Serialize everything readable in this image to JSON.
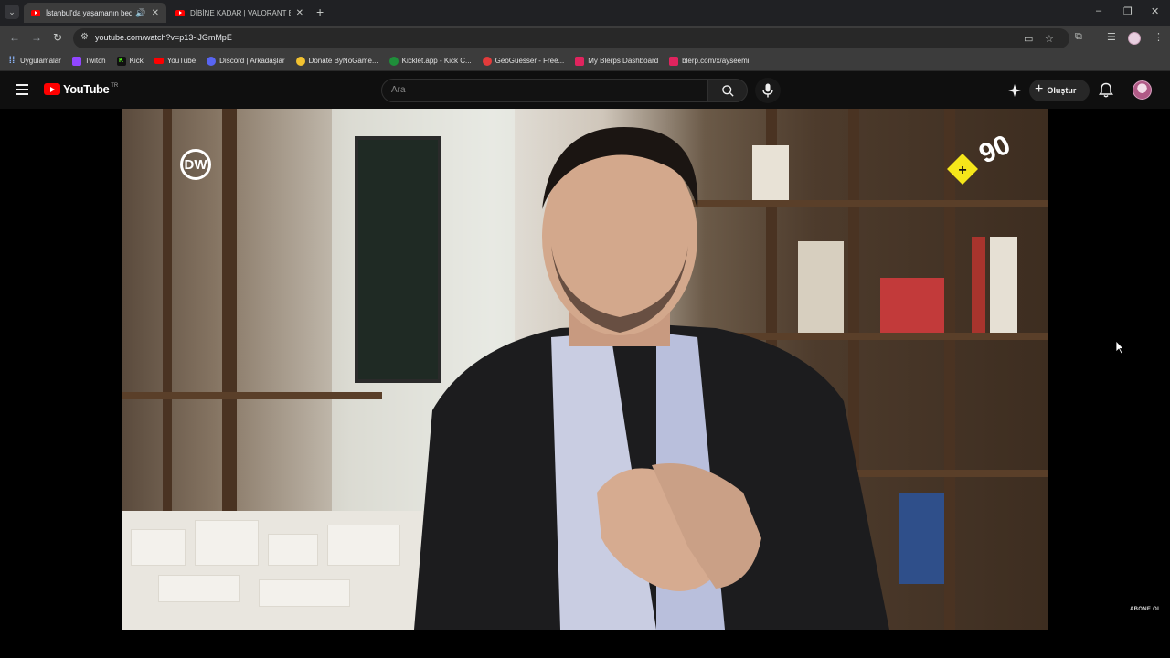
{
  "browser": {
    "tabs": [
      {
        "title": "İstanbul'da yaşamanın bedeli",
        "active": true,
        "audio": true,
        "favicon": "youtube-icon"
      },
      {
        "title": "DİBİNE KADAR | VALORANT ED",
        "active": false,
        "audio": false,
        "favicon": "youtube-icon"
      }
    ],
    "url": "youtube.com/watch?v=p13-iJGmMpE",
    "bookmarks": [
      {
        "label": "Uygulamalar",
        "icon": "apps-grid-icon",
        "color": "#8ab4f8"
      },
      {
        "label": "Twitch",
        "icon": "twitch-icon",
        "color": "#9146ff"
      },
      {
        "label": "Kick",
        "icon": "kick-icon",
        "color": "#53fc18"
      },
      {
        "label": "YouTube",
        "icon": "youtube-icon",
        "color": "#ff0000"
      },
      {
        "label": "Discord | Arkadaşlar",
        "icon": "discord-icon",
        "color": "#5865f2"
      },
      {
        "label": "Donate ByNoGame...",
        "icon": "bynogame-icon",
        "color": "#f2c230"
      },
      {
        "label": "Kicklet.app - Kick C...",
        "icon": "kicklet-icon",
        "color": "#1f8f3a"
      },
      {
        "label": "GeoGuesser - Free...",
        "icon": "geoguesser-icon",
        "color": "#e33b3b"
      },
      {
        "label": "My Blerps Dashboard",
        "icon": "blerp-icon",
        "color": "#e0245e"
      },
      {
        "label": "blerp.com/x/ayseemi",
        "icon": "blerp-icon",
        "color": "#e0245e"
      }
    ]
  },
  "youtube": {
    "logo_text": "YouTube",
    "country_code": "TR",
    "search_placeholder": "Ara",
    "create_label": "Oluştur"
  },
  "video": {
    "left_logo": "DW",
    "right_logo": "+90",
    "end_tag": "ABONE OL"
  },
  "colors": {
    "brand_red": "#ff0000",
    "plus90_yellow": "#f5e61a",
    "background": "#0f0f0f"
  }
}
